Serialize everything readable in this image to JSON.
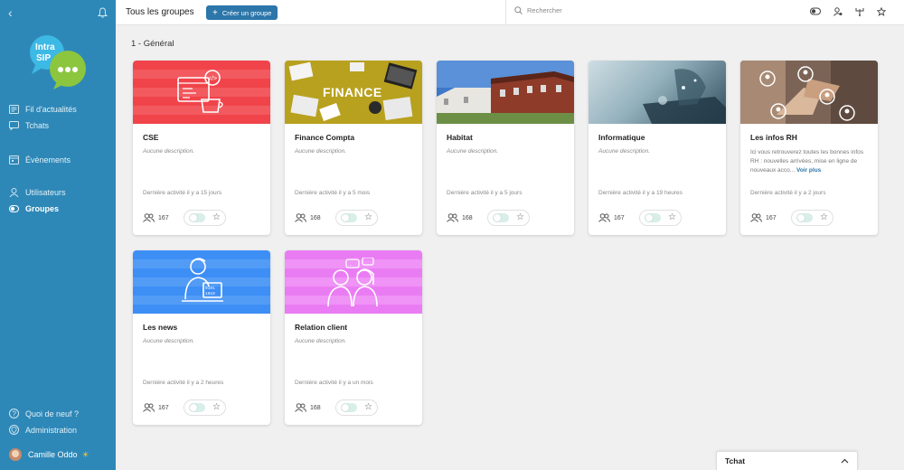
{
  "sidebar": {
    "logo": {
      "line1": "Intra",
      "line2": "SIP"
    },
    "items": [
      {
        "label": "Fil d'actualités",
        "icon": "news-icon"
      },
      {
        "label": "Tchats",
        "icon": "chat-icon"
      },
      {
        "label": "Évènements",
        "icon": "calendar-icon"
      },
      {
        "label": "Utilisateurs",
        "icon": "users-icon"
      },
      {
        "label": "Groupes",
        "icon": "groups-icon",
        "active": true
      }
    ],
    "bottom_items": [
      {
        "label": "Quoi de neuf ?",
        "icon": "question-icon"
      },
      {
        "label": "Administration",
        "icon": "shield-icon"
      }
    ],
    "user": {
      "name": "Camille Oddo",
      "badge": "sun-icon"
    }
  },
  "header": {
    "title": "Tous les groupes",
    "create_button": "Créer un groupe",
    "search_placeholder": "Rechercher"
  },
  "section": {
    "title": "1 - Général"
  },
  "groups": [
    {
      "title": "CSE",
      "description": "Aucune description.",
      "activity": "Dernière activité il y a 15 jours",
      "members": "167"
    },
    {
      "title": "Finance Compta",
      "description": "Aucune description.",
      "activity": "Dernière activité il y a 5 mois",
      "members": "168",
      "banner_text": "FINANCE"
    },
    {
      "title": "Habitat",
      "description": "Aucune description.",
      "activity": "Dernière activité il y a 5 jours",
      "members": "168"
    },
    {
      "title": "Informatique",
      "description": "Aucune description.",
      "activity": "Dernière activité il y a 19 heures",
      "members": "167"
    },
    {
      "title": "Les infos RH",
      "description": "Ici vous retrouverez toutes les bonnes infos RH : nouvelles arrivées, mise en ligne de nouveaux acco...",
      "more": "Voir plus",
      "activity": "Dernière activité il y a 2 jours",
      "members": "167"
    },
    {
      "title": "Les news",
      "description": "Aucune description.",
      "activity": "Dernière activité il y a 2 heures",
      "members": "167"
    },
    {
      "title": "Relation client",
      "description": "Aucune description.",
      "activity": "Dernière activité il y a un mois",
      "members": "168"
    }
  ],
  "tchat": {
    "label": "Tchat"
  },
  "colors": {
    "sidebar": "#2e88b7",
    "accent": "#2c76a9",
    "cse": "#f0444a",
    "news": "#3d8ef5",
    "relation": "#ea7cf3"
  }
}
